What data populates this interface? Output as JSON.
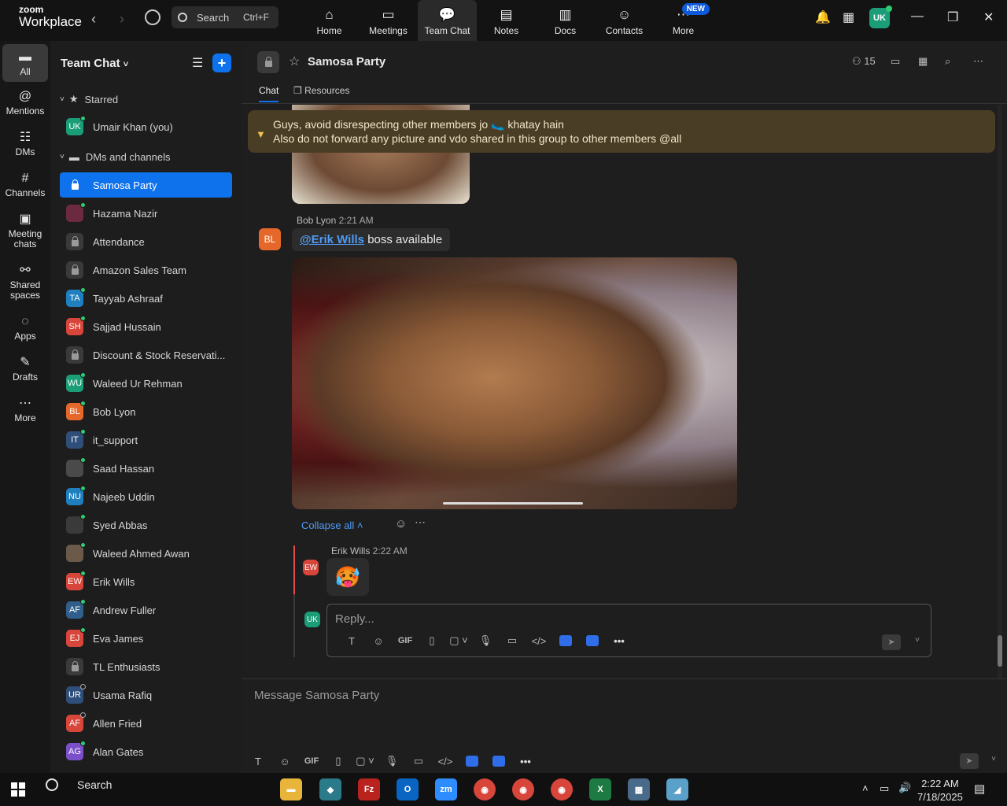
{
  "app": {
    "logo_top": "zoom",
    "logo_bottom": "Workplace",
    "search_label": "Search",
    "search_shortcut": "Ctrl+F",
    "nav": [
      {
        "label": "Home",
        "icon": "home-icon",
        "glyph": "⌂"
      },
      {
        "label": "Meetings",
        "icon": "video-icon",
        "glyph": "▭"
      },
      {
        "label": "Team Chat",
        "icon": "chat-icon",
        "glyph": "💬"
      },
      {
        "label": "Notes",
        "icon": "notes-icon",
        "glyph": "▤"
      },
      {
        "label": "Docs",
        "icon": "docs-icon",
        "glyph": "▥"
      },
      {
        "label": "Contacts",
        "icon": "contacts-icon",
        "glyph": "☺"
      },
      {
        "label": "More",
        "icon": "more-icon",
        "glyph": "⋯",
        "badge": "NEW"
      }
    ],
    "avatar_initials": "UK",
    "accent": "#0e72ed"
  },
  "rail": [
    {
      "label": "All",
      "icon": "chat-bubble-icon",
      "glyph": "▬"
    },
    {
      "label": "Mentions",
      "icon": "at-icon",
      "glyph": "@"
    },
    {
      "label": "DMs",
      "icon": "people-icon",
      "glyph": "☷"
    },
    {
      "label": "Channels",
      "icon": "hash-icon",
      "glyph": "#"
    },
    {
      "label": "Meeting chats",
      "icon": "calendar-chat-icon",
      "glyph": "▣"
    },
    {
      "label": "Shared spaces",
      "icon": "share-icon",
      "glyph": "⚯"
    },
    {
      "label": "Apps",
      "icon": "apps-icon",
      "glyph": "◌"
    },
    {
      "label": "Drafts",
      "icon": "drafts-icon",
      "glyph": "✎"
    },
    {
      "label": "More",
      "icon": "more-icon",
      "glyph": "⋯"
    }
  ],
  "sidebar": {
    "title": "Team Chat",
    "starred_label": "Starred",
    "dms_label": "DMs and channels",
    "starred": [
      {
        "label": "Umair Khan (you)",
        "initials": "UK",
        "color": "#1b9e77",
        "type": "avatar",
        "status": true
      }
    ],
    "items": [
      {
        "label": "Samosa Party",
        "type": "lock",
        "active": true
      },
      {
        "label": "Hazama Nazir",
        "initials": "",
        "color": "#6b2a3f",
        "type": "avatar",
        "status": true
      },
      {
        "label": "Attendance",
        "type": "lock"
      },
      {
        "label": "Amazon Sales Team",
        "type": "lock"
      },
      {
        "label": "Tayyab Ashraaf",
        "initials": "TA",
        "color": "#1f7fbf",
        "type": "avatar",
        "status": true
      },
      {
        "label": "Sajjad Hussain",
        "initials": "SH",
        "color": "#d8453a",
        "type": "avatar",
        "status": true
      },
      {
        "label": "Discount & Stock Reservati...",
        "type": "lock"
      },
      {
        "label": "Waleed Ur Rehman",
        "initials": "WU",
        "color": "#1b9e77",
        "type": "avatar",
        "status": true
      },
      {
        "label": "Bob Lyon",
        "initials": "BL",
        "color": "#e5682a",
        "type": "avatar",
        "status": true
      },
      {
        "label": "it_support",
        "initials": "IT",
        "color": "#2f4f7a",
        "type": "avatar",
        "status": true
      },
      {
        "label": "Saad Hassan",
        "initials": "",
        "color": "#4a4a4a",
        "type": "avatar",
        "status": true
      },
      {
        "label": "Najeeb Uddin",
        "initials": "NU",
        "color": "#1f7fbf",
        "type": "avatar",
        "status": true
      },
      {
        "label": "Syed Abbas",
        "initials": "",
        "color": "#3a3a3a",
        "type": "avatar",
        "status": true
      },
      {
        "label": "Waleed Ahmed Awan",
        "initials": "",
        "color": "#6b5a4a",
        "type": "avatar",
        "status": true
      },
      {
        "label": "Erik Wills",
        "initials": "EW",
        "color": "#d8453a",
        "type": "avatar",
        "status": true
      },
      {
        "label": "Andrew Fuller",
        "initials": "AF",
        "color": "#2f5f8a",
        "type": "avatar",
        "status": true
      },
      {
        "label": "Eva James",
        "initials": "EJ",
        "color": "#d8453a",
        "type": "avatar",
        "status": true
      },
      {
        "label": "TL Enthusiasts",
        "type": "lock"
      },
      {
        "label": "Usama Rafiq",
        "initials": "UR",
        "color": "#2f4f7a",
        "type": "avatar",
        "status": false
      },
      {
        "label": "Allen Fried",
        "initials": "AF",
        "color": "#d8453a",
        "type": "avatar",
        "status": false
      },
      {
        "label": "Alan Gates",
        "initials": "AG",
        "color": "#7b4fc9",
        "type": "avatar",
        "status": true
      }
    ]
  },
  "channel": {
    "title": "Samosa Party",
    "member_count": "15",
    "tabs": [
      "Chat",
      "Resources"
    ],
    "pinned_line1": "Guys, avoid disrespecting other members jo 🥿 khatay hain",
    "pinned_line2": "Also do not forward any picture and vdo shared in this group to other members @all",
    "msg1_sender": "Bob Lyon",
    "msg1_time": "2:21 AM",
    "msg1_initials": "BL",
    "msg1_mention": "@Erik Wills",
    "msg1_text": " boss available",
    "collapse_label": "Collapse all ˄",
    "reply_sender": "Erik Wills",
    "reply_time": "2:22 AM",
    "reply_initials": "EW",
    "reply_emoji": "🥵",
    "reply_me_initials": "UK",
    "reply_placeholder": "Reply...",
    "composer_placeholder": "Message Samosa Party",
    "toolbar": [
      "T",
      "☺",
      "GIF",
      "▯",
      "▢ ˅",
      "🎙",
      "▭",
      "</>"
    ]
  },
  "taskbar": {
    "search_label": "Search",
    "time": "2:22 AM",
    "date": "7/18/2025"
  }
}
